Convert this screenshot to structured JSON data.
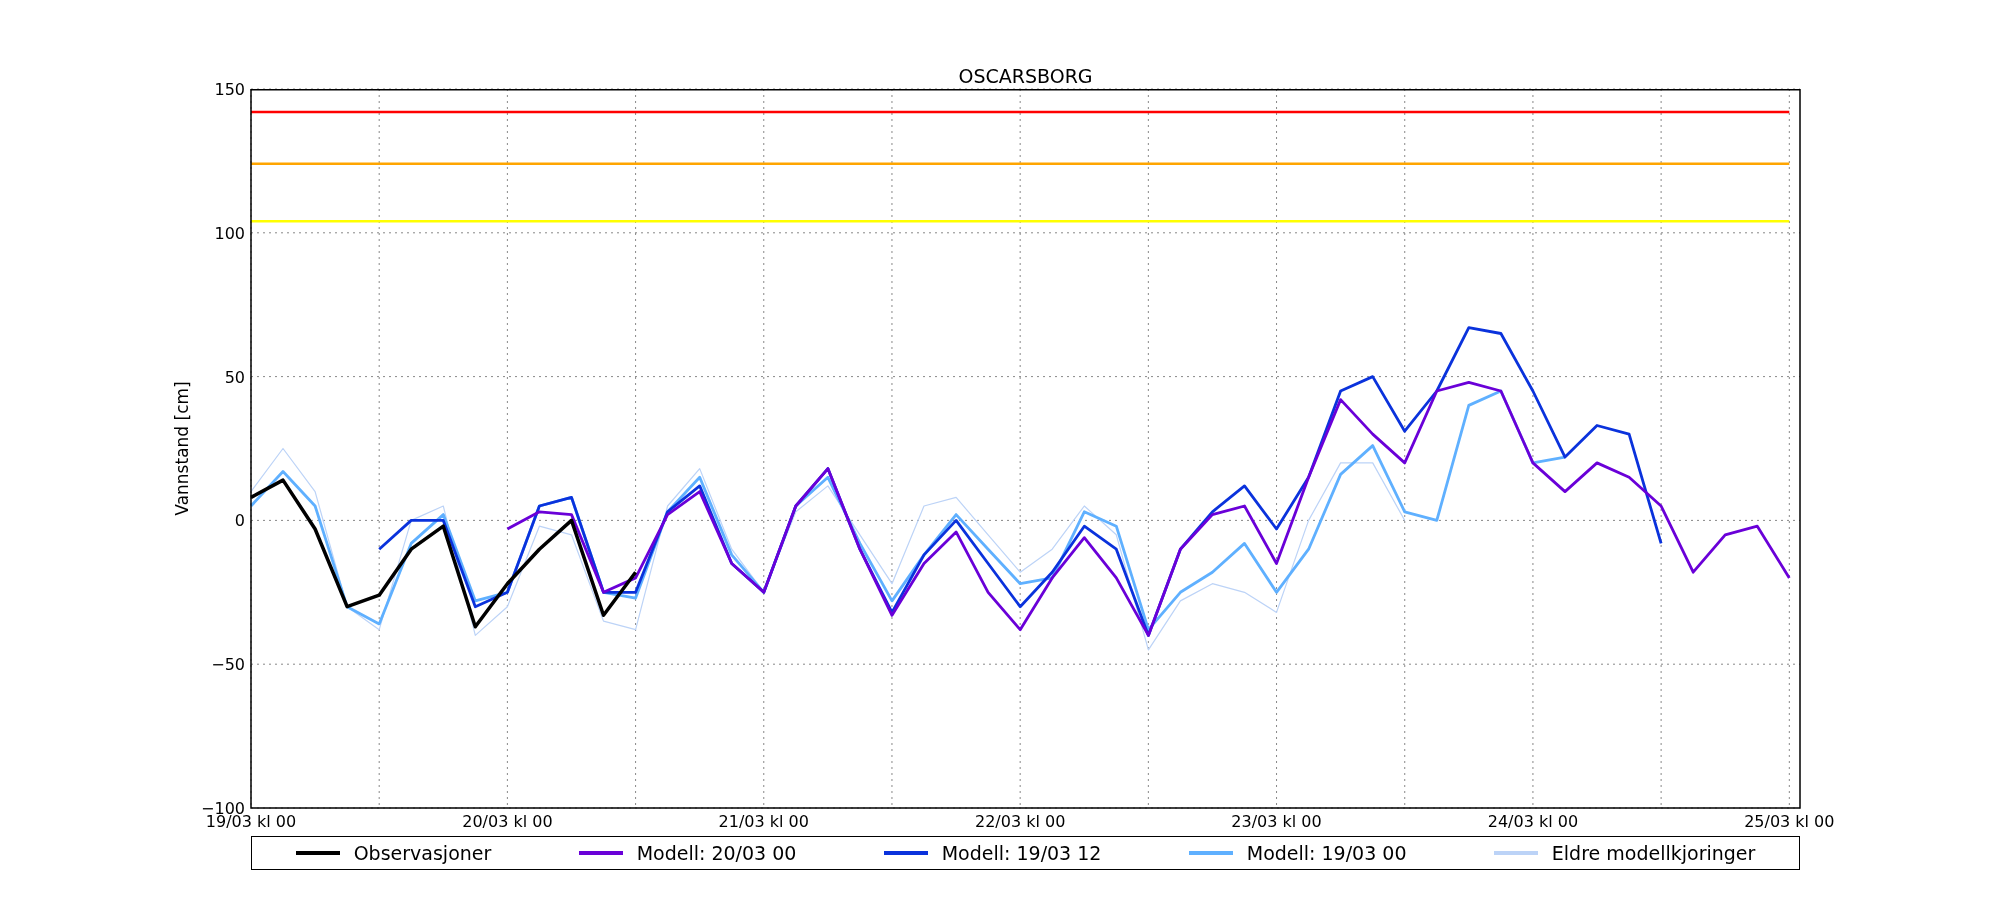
{
  "figure": {
    "title": "OSCARSBORG",
    "chart_data": {
      "type": "line",
      "ylabel": "Vannstand [cm]",
      "categories": [
        "19/03 kl 00",
        null,
        null,
        null,
        null,
        null,
        null,
        null,
        "20/03 kl 00",
        null,
        null,
        null,
        null,
        null,
        null,
        null,
        "21/03 kl 00",
        null,
        null,
        null,
        null,
        null,
        null,
        null,
        "22/03 kl 00",
        null,
        null,
        null,
        null,
        null,
        null,
        null,
        "23/03 kl 00",
        null,
        null,
        null,
        null,
        null,
        null,
        null,
        "24/03 kl 00",
        null,
        null,
        null,
        null,
        null,
        null,
        null,
        "25/03 kl 00"
      ],
      "ylim": [
        -100,
        150
      ],
      "grid": true,
      "yticks": [
        {
          "value": -100,
          "label": "−100"
        },
        {
          "value": -50,
          "label": "−50"
        },
        {
          "value": 0,
          "label": "0"
        },
        {
          "value": 50,
          "label": "50"
        },
        {
          "value": 100,
          "label": "100"
        },
        {
          "value": 150,
          "label": "150"
        }
      ],
      "series": [
        {
          "name": "Observasjoner",
          "color": "#000000",
          "values": [
            8,
            14,
            -3,
            -30,
            -26,
            -10,
            -2,
            -37,
            -22,
            -10,
            0,
            -33,
            -18,
            null,
            null,
            null,
            null,
            null,
            null,
            null,
            null,
            null,
            null,
            null,
            null,
            null,
            null,
            null,
            null,
            null,
            null,
            null,
            null,
            null,
            null,
            null,
            null,
            null,
            null,
            null,
            null,
            null,
            null,
            null,
            null,
            null,
            null,
            null,
            null
          ]
        },
        {
          "name": "Modell: 20/03 00",
          "color": "#6a00d8",
          "values": [
            null,
            null,
            null,
            null,
            null,
            null,
            null,
            null,
            -3,
            3,
            2,
            -25,
            -20,
            2,
            10,
            -15,
            -25,
            5,
            18,
            -10,
            -33,
            -15,
            -4,
            -25,
            -38,
            -20,
            -6,
            -20,
            -40,
            -10,
            2,
            5,
            -15,
            15,
            42,
            30,
            20,
            45,
            48,
            45,
            20,
            10,
            20,
            15,
            5,
            -18,
            -5,
            -2,
            -20
          ]
        },
        {
          "name": "Modell: 19/03 12",
          "color": "#0a32dc",
          "values": [
            null,
            null,
            null,
            null,
            -10,
            0,
            0,
            -30,
            -25,
            5,
            8,
            -25,
            -25,
            3,
            12,
            -15,
            -25,
            5,
            18,
            -10,
            -32,
            -12,
            0,
            -15,
            -30,
            -18,
            -2,
            -10,
            -40,
            -10,
            3,
            12,
            -3,
            15,
            45,
            50,
            31,
            45,
            67,
            65,
            45,
            22,
            33,
            30,
            -8,
            null,
            null,
            null,
            null
          ]
        },
        {
          "name": "Modell: 19/03 00",
          "color": "#5fb0ff",
          "values": [
            5,
            17,
            5,
            -30,
            -36,
            -8,
            2,
            -28,
            -25,
            5,
            8,
            -25,
            -27,
            3,
            15,
            -12,
            -25,
            5,
            15,
            -8,
            -28,
            -12,
            2,
            -10,
            -22,
            -20,
            3,
            -2,
            -38,
            -25,
            -18,
            -8,
            -25,
            -10,
            16,
            26,
            3,
            0,
            40,
            45,
            20,
            22,
            null,
            null,
            null,
            null,
            null,
            null,
            null
          ]
        },
        {
          "name": "Eldre modellkjoringer",
          "color": "#bcd3f7",
          "values": [
            10,
            25,
            10,
            -30,
            -38,
            0,
            5,
            -40,
            -30,
            -2,
            -5,
            -35,
            -38,
            5,
            18,
            -10,
            -25,
            3,
            12,
            -5,
            -22,
            5,
            8,
            -5,
            -18,
            -10,
            5,
            -5,
            -45,
            -28,
            -22,
            -25,
            -32,
            0,
            20,
            20,
            0,
            null,
            null,
            null,
            null,
            null,
            null,
            null,
            null,
            null,
            null,
            null,
            null
          ]
        },
        {
          "color": "#ff0000",
          "values": [
            142,
            142,
            142,
            142,
            142,
            142,
            142,
            142,
            142,
            142,
            142,
            142,
            142,
            142,
            142,
            142,
            142,
            142,
            142,
            142,
            142,
            142,
            142,
            142,
            142,
            142,
            142,
            142,
            142,
            142,
            142,
            142,
            142,
            142,
            142,
            142,
            142,
            142,
            142,
            142,
            142,
            142,
            142,
            142,
            142,
            142,
            142,
            142,
            142
          ]
        },
        {
          "color": "#ffa500",
          "values": [
            124,
            124,
            124,
            124,
            124,
            124,
            124,
            124,
            124,
            124,
            124,
            124,
            124,
            124,
            124,
            124,
            124,
            124,
            124,
            124,
            124,
            124,
            124,
            124,
            124,
            124,
            124,
            124,
            124,
            124,
            124,
            124,
            124,
            124,
            124,
            124,
            124,
            124,
            124,
            124,
            124,
            124,
            124,
            124,
            124,
            124,
            124,
            124,
            124
          ]
        },
        {
          "color": "#ffff00",
          "values": [
            104,
            104,
            104,
            104,
            104,
            104,
            104,
            104,
            104,
            104,
            104,
            104,
            104,
            104,
            104,
            104,
            104,
            104,
            104,
            104,
            104,
            104,
            104,
            104,
            104,
            104,
            104,
            104,
            104,
            104,
            104,
            104,
            104,
            104,
            104,
            104,
            104,
            104,
            104,
            104,
            104,
            104,
            104,
            104,
            104,
            104,
            104,
            104,
            104
          ]
        }
      ]
    }
  }
}
